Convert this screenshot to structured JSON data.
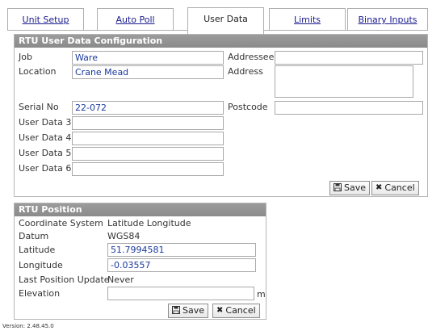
{
  "tabs": [
    {
      "label": "Unit Setup",
      "active": false
    },
    {
      "label": "Auto Poll",
      "active": false
    },
    {
      "label": "User Data",
      "active": true
    },
    {
      "label": "Limits",
      "active": false
    },
    {
      "label": "Binary Inputs",
      "active": false
    }
  ],
  "user_data": {
    "title": "RTU User Data Configuration",
    "job_label": "Job",
    "job_value": "Ware",
    "location_label": "Location",
    "location_value": "Crane Mead",
    "serial_label": "Serial No",
    "serial_value": "22-072",
    "ud3_label": "User Data 3",
    "ud3_value": "",
    "ud4_label": "User Data 4",
    "ud4_value": "",
    "ud5_label": "User Data 5",
    "ud5_value": "",
    "ud6_label": "User Data 6",
    "ud6_value": "",
    "addressee_label": "Addressee",
    "addressee_value": "",
    "address_label": "Address",
    "address_value": "",
    "postcode_label": "Postcode",
    "postcode_value": "",
    "save_label": "Save",
    "cancel_label": "Cancel"
  },
  "position": {
    "title": "RTU Position",
    "coord_label": "Coordinate System",
    "coord_value": "Latitude Longitude",
    "datum_label": "Datum",
    "datum_value": "WGS84",
    "lat_label": "Latitude",
    "lat_value": "51.7994581",
    "lon_label": "Longitude",
    "lon_value": "-0.03557",
    "last_update_label": "Last Position Update",
    "last_update_value": "Never",
    "elevation_label": "Elevation",
    "elevation_value": "",
    "elevation_unit": "m",
    "save_label": "Save",
    "cancel_label": "Cancel"
  },
  "footer": {
    "version": "Version: 2.48.45.0"
  },
  "icons": {
    "save": "floppy-disk-icon",
    "cancel": "x-icon"
  }
}
